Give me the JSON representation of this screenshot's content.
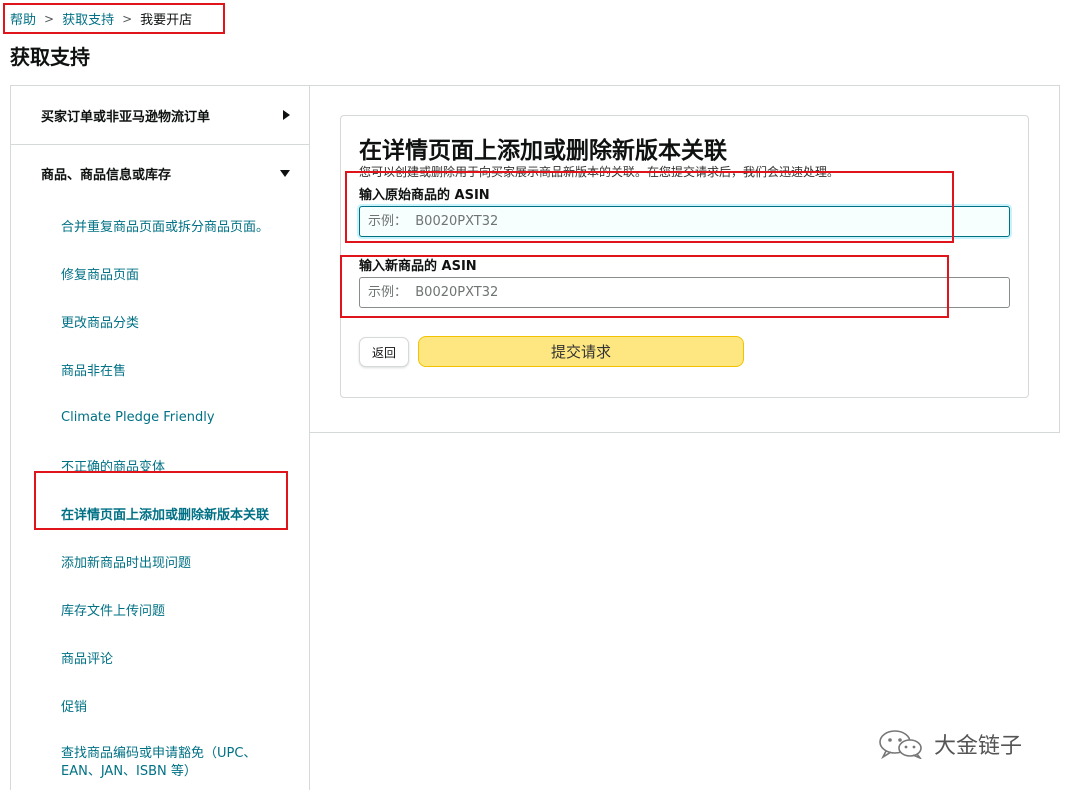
{
  "breadcrumb": {
    "items": [
      "帮助",
      "获取支持",
      "我要开店"
    ],
    "separator": ">"
  },
  "page_title": "获取支持",
  "sidebar": {
    "sections": [
      {
        "label": "买家订单或非亚马逊物流订单",
        "state": "collapsed"
      },
      {
        "label": "商品、商品信息或库存",
        "state": "expanded"
      }
    ],
    "items": [
      {
        "label": "合并重复商品页面或拆分商品页面。"
      },
      {
        "label": "修复商品页面"
      },
      {
        "label": "更改商品分类"
      },
      {
        "label": "商品非在售"
      },
      {
        "label": "Climate Pledge Friendly"
      },
      {
        "label": "不正确的商品变体"
      },
      {
        "label": "在详情页面上添加或删除新版本关联",
        "active": true
      },
      {
        "label": "添加新商品时出现问题"
      },
      {
        "label": "库存文件上传问题"
      },
      {
        "label": "商品评论"
      },
      {
        "label": "促销"
      },
      {
        "label": "查找商品编码或申请豁免（UPC、EAN、JAN、ISBN 等）"
      }
    ]
  },
  "form": {
    "title": "在详情页面上添加或删除新版本关联",
    "description": "您可以创建或删除用于向买家展示商品新版本的关联。在您提交请求后，我们会迅速处理。",
    "original_asin_label": "输入原始商品的 ASIN",
    "original_asin_placeholder": "示例：  B0020PXT32",
    "original_asin_value": "",
    "new_asin_label": "输入新商品的 ASIN",
    "new_asin_placeholder": "示例：  B0020PXT32",
    "new_asin_value": "",
    "back_label": "返回",
    "submit_label": "提交请求"
  },
  "watermark": {
    "text": "大金链子",
    "icon": "wechat-icon"
  },
  "colors": {
    "link": "#007185",
    "annotation": "#e0151b",
    "submit_bg": "#fee781",
    "border": "#d5d9d9"
  }
}
